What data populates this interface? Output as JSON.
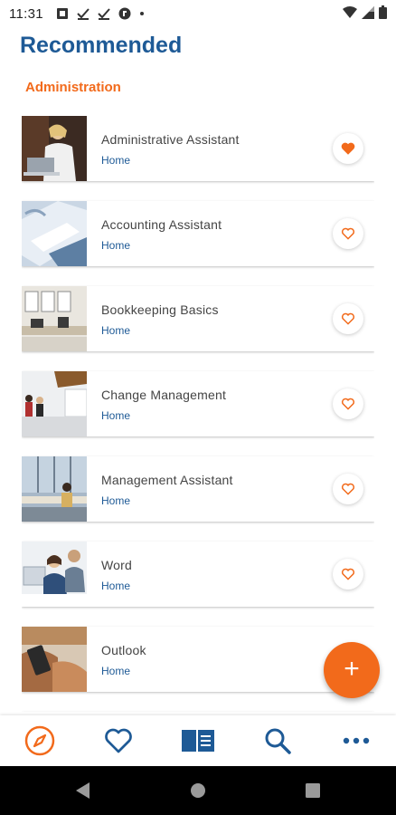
{
  "status_bar": {
    "time": "11:31",
    "left_icons": [
      "notification-app-icon",
      "check-icon",
      "check-icon",
      "app-icon",
      "dot-icon"
    ],
    "right_icons": [
      "wifi-icon",
      "signal-icon",
      "battery-icon"
    ]
  },
  "header": {
    "title": "Recommended"
  },
  "section": {
    "title": "Administration"
  },
  "courses": [
    {
      "title": "Administrative Assistant",
      "category": "Home",
      "favorited": true,
      "thumb_icon": "woman-laptop-photo"
    },
    {
      "title": "Accounting Assistant",
      "category": "Home",
      "favorited": false,
      "thumb_icon": "documents-laptop-photo"
    },
    {
      "title": "Bookkeeping Basics",
      "category": "Home",
      "favorited": false,
      "thumb_icon": "office-room-photo"
    },
    {
      "title": "Change Management",
      "category": "Home",
      "favorited": false,
      "thumb_icon": "office-meeting-photo"
    },
    {
      "title": "Management Assistant",
      "category": "Home",
      "favorited": false,
      "thumb_icon": "office-window-photo"
    },
    {
      "title": "Word",
      "category": "Home",
      "favorited": false,
      "thumb_icon": "people-computer-photo"
    },
    {
      "title": "Outlook",
      "category": "Home",
      "favorited": false,
      "thumb_icon": "hands-phone-photo"
    }
  ],
  "fab": {
    "label": "+"
  },
  "bottom_nav": [
    {
      "icon": "compass-icon",
      "active": true
    },
    {
      "icon": "heart-icon",
      "active": false
    },
    {
      "icon": "catalog-icon",
      "active": false
    },
    {
      "icon": "search-icon",
      "active": false
    },
    {
      "icon": "more-icon",
      "active": false
    }
  ],
  "colors": {
    "brand_blue": "#1e5a96",
    "accent_orange": "#f26a1b",
    "text_gray": "#444444"
  }
}
